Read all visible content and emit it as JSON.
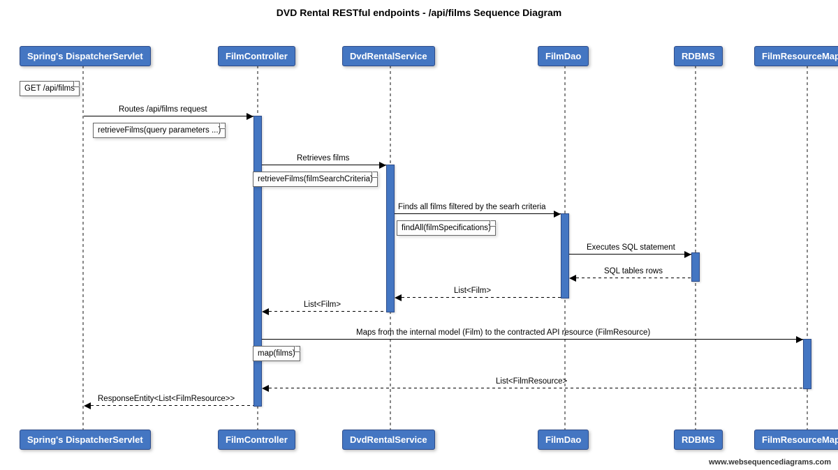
{
  "title": "DVD Rental RESTful endpoints - /api/films Sequence Diagram",
  "participants": {
    "p1": "Spring's DispatcherServlet",
    "p2": "FilmController",
    "p3": "DvdRentalService",
    "p4": "FilmDao",
    "p5": "RDBMS",
    "p6": "FilmResourceMapper"
  },
  "notes": {
    "n1": "GET /api/films",
    "n2": "retrieveFilms(query parameters ...)",
    "n3": "retrieveFilms(filmSearchCriteria)",
    "n4": "findAll(filmSpecifications)",
    "n5": "map(films)"
  },
  "messages": {
    "m1": "Routes /api/films request",
    "m2": "Retrieves films",
    "m3": "Finds all films filtered by the searh criteria",
    "m4": "Executes SQL statement",
    "m5": "SQL tables rows",
    "m6": "List<Film>",
    "m7": "List<Film>",
    "m8": "Maps from the internal model (Film) to the contracted API resource (FilmResource)",
    "m9": "List<FilmResource>",
    "m10": "ResponseEntity<List<FilmResource>>"
  },
  "attribution": "www.websequencediagrams.com"
}
